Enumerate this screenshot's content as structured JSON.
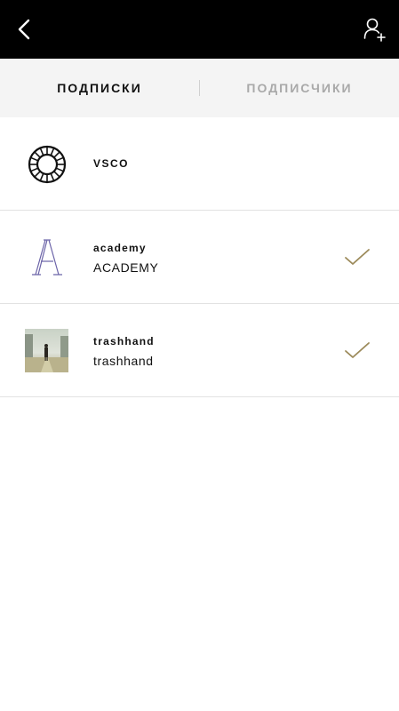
{
  "header": {
    "back_icon": "chevron-left-icon",
    "add_user_icon": "add-user-icon"
  },
  "tabs": [
    {
      "label": "ПОДПИСКИ",
      "active": true
    },
    {
      "label": "ПОДПИСЧИКИ",
      "active": false
    }
  ],
  "colors": {
    "topbar": "#000000",
    "tabbar": "#f4f4f4",
    "active_tab_text": "#111111",
    "inactive_tab_text": "#a9a9a9",
    "checkmark": "#9c8a5a",
    "academy_logo": "#6b63a8"
  },
  "following": [
    {
      "name": "VSCO",
      "avatar_icon": "vsco-logo-icon"
    },
    {
      "handle": "academy",
      "display_name": "ACADEMY",
      "avatar_icon": "academy-logo-icon",
      "followed": true
    },
    {
      "handle": "trashhand",
      "display_name": "trashhand",
      "avatar_icon": "photo-thumbnail",
      "followed": true
    }
  ]
}
